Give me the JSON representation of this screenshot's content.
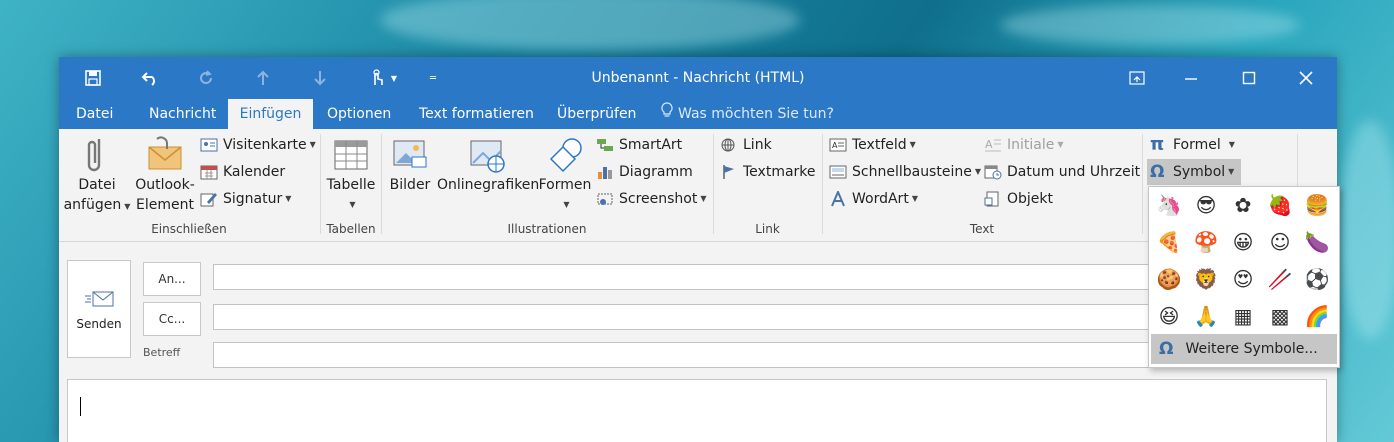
{
  "window": {
    "title": "Unbenannt - Nachricht (HTML)",
    "qat": {
      "save": "save-icon",
      "undo": "undo-icon",
      "redo": "redo-icon",
      "up": "up-arrow-icon",
      "down": "down-arrow-icon",
      "touch": "touch-mode-icon"
    }
  },
  "tabs": [
    "Datei",
    "Nachricht",
    "Einfügen",
    "Optionen",
    "Text formatieren",
    "Überprüfen"
  ],
  "active_tab": "Einfügen",
  "tell_me": "Was möchten Sie tun?",
  "groups": {
    "einschliessen": {
      "label": "Einschließen",
      "datei_line1": "Datei",
      "datei_line2": "anfügen",
      "outlook_line1": "Outlook-",
      "outlook_line2": "Element",
      "visitenkarte": "Visitenkarte",
      "kalender": "Kalender",
      "signatur": "Signatur"
    },
    "tabellen": {
      "label": "Tabellen",
      "tabelle": "Tabelle"
    },
    "illustrationen": {
      "label": "Illustrationen",
      "bilder": "Bilder",
      "onlinegrafiken": "Onlinegrafiken",
      "formen": "Formen",
      "smartart": "SmartArt",
      "diagramm": "Diagramm",
      "screenshot": "Screenshot"
    },
    "link": {
      "label": "Link",
      "link": "Link",
      "textmarke": "Textmarke"
    },
    "text": {
      "label": "Text",
      "textfeld": "Textfeld",
      "schnellbausteine": "Schnellbausteine",
      "wordart": "WordArt",
      "initiale": "Initiale",
      "datum": "Datum und Uhrzeit",
      "objekt": "Objekt"
    },
    "symbole": {
      "formel": "Formel",
      "symbol": "Symbol"
    }
  },
  "compose": {
    "send": "Senden",
    "an": "An...",
    "cc": "Cc...",
    "betreff": "Betreff"
  },
  "symbol_dropdown": {
    "symbols": [
      [
        "unicorn-icon",
        "sunglasses-face-icon",
        "flower-icon",
        "strawberry-icon",
        "burger-icon"
      ],
      [
        "pizza-slice-icon",
        "mushroom-icon",
        "grinning-face-icon",
        "smiling-face-icon",
        "eggplant-icon"
      ],
      [
        "cookie-icon",
        "lion-icon",
        "heart-eyes-face-icon",
        "chopsticks-icon",
        "soccer-ball-icon"
      ],
      [
        "laughing-face-icon",
        "praying-hands-icon",
        "stamp-icon",
        "postage-stamp-icon",
        "rainbow-icon"
      ]
    ],
    "glyphs": [
      [
        "🦄",
        "😎",
        "✿",
        "🍓",
        "🍔"
      ],
      [
        "🍕",
        "🍄",
        "😀",
        "☺",
        "🍆"
      ],
      [
        "🍪",
        "🦁",
        "😍",
        "🥢",
        "⚽"
      ],
      [
        "😆",
        "🙏",
        "▦",
        "▩",
        "🌈"
      ]
    ],
    "more": "Weitere Symbole..."
  }
}
